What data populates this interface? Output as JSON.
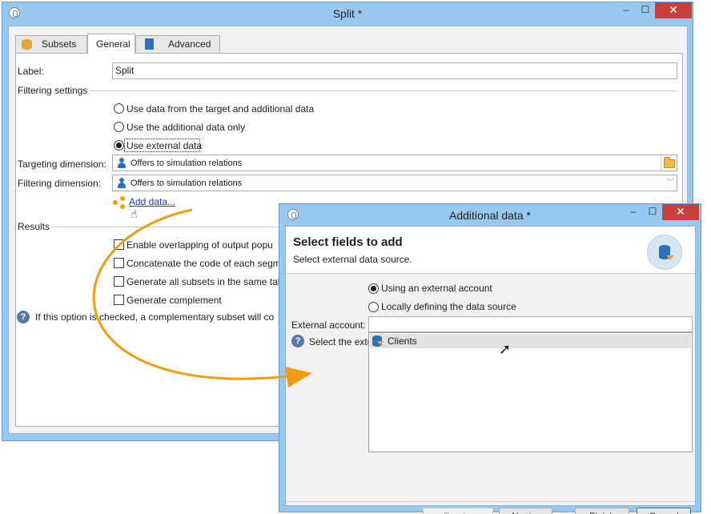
{
  "split_window": {
    "title": "Split *",
    "controls": {
      "minimize": "–",
      "maximize": "☐",
      "close": "✕"
    },
    "tabs": [
      {
        "label": "Subsets",
        "icon": "database-icon"
      },
      {
        "label": "General"
      },
      {
        "label": "Advanced",
        "icon": "clipboard-icon"
      }
    ],
    "active_tab": "General",
    "label_field": {
      "label": "Label:",
      "value": "Split"
    },
    "filtering_settings": {
      "heading": "Filtering settings",
      "options": [
        "Use data from the target and additional data",
        "Use the additional data only",
        "Use external data"
      ],
      "selected": "Use external data"
    },
    "targeting_dimension": {
      "label": "Targeting dimension:",
      "value": "Offers to simulation relations"
    },
    "filtering_dimension": {
      "label": "Filtering dimension:",
      "value": "Offers to simulation relations"
    },
    "add_data_link": "Add data...",
    "results": {
      "heading": "Results",
      "options": [
        "Enable overlapping of output popu",
        "Concatenate the code of each segm",
        "Generate all subsets in the same tab",
        "Generate complement"
      ],
      "help_text": "If this option is checked, a complementary subset will co"
    }
  },
  "additional_data_window": {
    "title": "Additional data *",
    "controls": {
      "minimize": "–",
      "maximize": "☐",
      "close": "✕"
    },
    "header_title": "Select fields to add",
    "header_subtitle": "Select external data source.",
    "options": [
      "Using an external account",
      "Locally defining the data source"
    ],
    "selected": "Using an external account",
    "external_account": {
      "label": "External account:",
      "value": ""
    },
    "help_text": "Select the exte",
    "dropdown_items": [
      {
        "label": "Clients",
        "icon": "database-icon"
      }
    ],
    "buttons": {
      "previous": "< Previous",
      "next": "Next >",
      "finish": "Finish",
      "cancel": "Cancel"
    }
  },
  "colors": {
    "window_frame": "#99c8ee",
    "close_button": "#c7413a",
    "link": "#1b3fae",
    "annotation_arrow": "#f39c12"
  }
}
